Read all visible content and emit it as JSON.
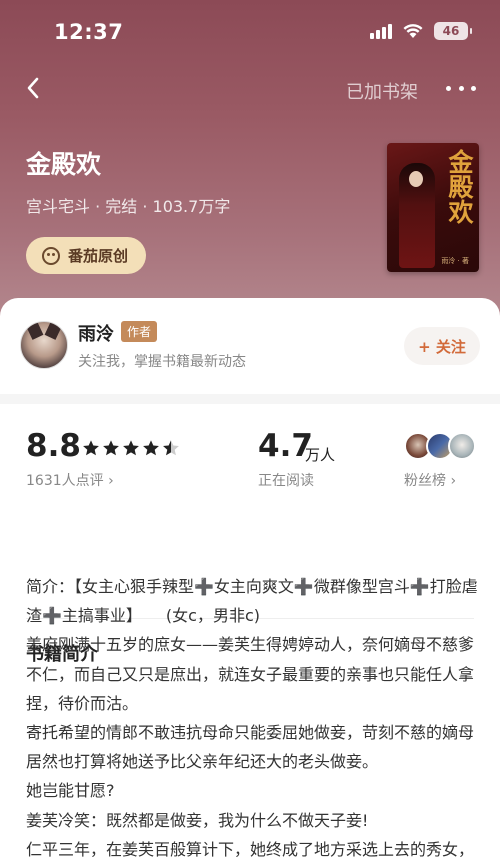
{
  "status": {
    "time": "12:37",
    "battery": "46"
  },
  "nav": {
    "shelf_label": "已加书架"
  },
  "book": {
    "title": "金殿欢",
    "meta": "宫斗宅斗 · 完结 · 103.7万字",
    "badge": "番茄原创",
    "cover_title": "金殿欢",
    "cover_author": "雨泠 · 著"
  },
  "author": {
    "name": "雨泠",
    "tag": "作者",
    "subtitle": "关注我，掌握书籍最新动态",
    "follow_label": "+ 关注"
  },
  "stats": {
    "score": "8.8",
    "stars": 4.5,
    "rating_count": "1631人点评 ›",
    "readers": "4.7",
    "readers_unit": "万人",
    "reading_label": "正在阅读",
    "fans_label": "粉丝榜 ›"
  },
  "intro": {
    "heading": "书籍简介",
    "paragraphs": [
      "简介：【女主心狠手辣型➕女主向爽文➕微群像型宫斗➕打脸虐渣➕主搞事业】　　(女c，男非c)",
      "姜府刚满十五岁的庶女——姜芙生得娉婷动人，奈何嫡母不慈爹不仁，而自己又只是庶出，就连女子最重要的亲事也只能任人拿捏，待价而沽。",
      "寄托希望的情郎不敢违抗母命只能委屈她做妾，苛刻不慈的嫡母居然也打算将她送予比父亲年纪还大的老头做妾。",
      "她岂能甘愿?",
      "姜芙冷笑：既然都是做妾，我为什么不做天子妾!",
      "仁平三年，在姜芙百般算计下，她终成了地方采选上去的秀女，从卑微庶女到登顶后宫至高无上的权力宝座，没人"
    ]
  },
  "colors": {
    "accent": "#d26a3a",
    "hero": "#8c4a56",
    "badge_bg": "#f3dfb8"
  }
}
